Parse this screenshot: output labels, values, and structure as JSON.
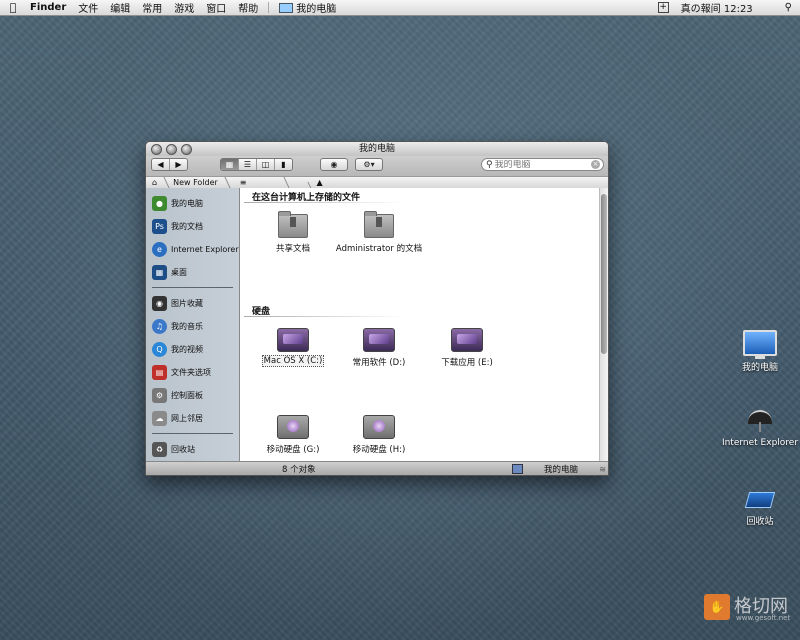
{
  "menubar": {
    "app_name": "Finder",
    "items": [
      "文件",
      "编辑",
      "常用",
      "游戏",
      "窗口",
      "帮助"
    ],
    "window_item": "我的电脑",
    "clock": "真の報间 12:23"
  },
  "window": {
    "title": "我的电脑",
    "search_placeholder": "我的电脑",
    "path": {
      "folder": "New Folder"
    },
    "sidebar": {
      "group1": [
        {
          "label": "我的电脑",
          "icon": "android-computer-icon",
          "color": "#3d8a2f"
        },
        {
          "label": "我的文档",
          "icon": "photoshop-icon",
          "color": "#1d4f8c"
        },
        {
          "label": "Internet Explorer",
          "icon": "ie-icon",
          "color": "#2a6fc0"
        },
        {
          "label": "桌面",
          "icon": "windows-desktop-icon",
          "color": "#1c4d87"
        }
      ],
      "group2": [
        {
          "label": "图片收藏",
          "icon": "camera-icon",
          "color": "#333333"
        },
        {
          "label": "我的音乐",
          "icon": "itunes-icon",
          "color": "#3b78c9"
        },
        {
          "label": "我的视频",
          "icon": "quicktime-icon",
          "color": "#2a86d6"
        },
        {
          "label": "文件夹选项",
          "icon": "phonebox-icon",
          "color": "#c0302a"
        },
        {
          "label": "控制面板",
          "icon": "control-panel-icon",
          "color": "#777777"
        },
        {
          "label": "网上邻居",
          "icon": "network-icon",
          "color": "#8a8a8a"
        }
      ],
      "group3": [
        {
          "label": "回收站",
          "icon": "trash-icon",
          "color": "#555555"
        }
      ]
    },
    "sections": {
      "documents_title": "在这台计算机上存储的文件",
      "drives_title": "硬盘"
    },
    "documents": [
      {
        "label": "共享文档"
      },
      {
        "label": "Administrator 的文档"
      }
    ],
    "drives": [
      {
        "label": "Mac OS X (C:)",
        "type": "disk",
        "selected": true
      },
      {
        "label": "常用软件 (D:)",
        "type": "disk"
      },
      {
        "label": "下载应用 (E:)",
        "type": "disk"
      },
      {
        "label": "移动硬盘 (G:)",
        "type": "usb"
      },
      {
        "label": "移动硬盘 (H:)",
        "type": "usb"
      }
    ],
    "status": {
      "count": "8 个对象",
      "location": "我的电脑"
    }
  },
  "desktop": [
    {
      "label": "我的电脑",
      "icon": "monitor-icon"
    },
    {
      "label": "Internet Explorer",
      "icon": "ie-umbrella-icon"
    },
    {
      "label": "回收站",
      "icon": "recycle-bin-icon"
    }
  ],
  "watermark": {
    "text": "格切网",
    "sub": "www.gesoft.net"
  }
}
